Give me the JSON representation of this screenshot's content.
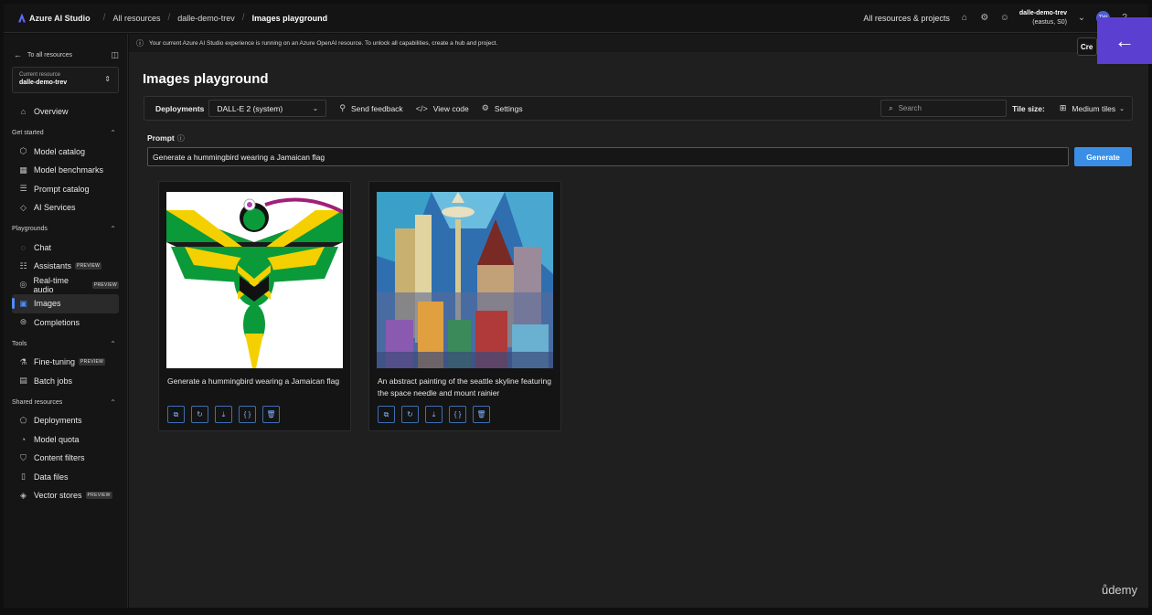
{
  "topbar": {
    "app_name": "Azure AI Studio",
    "breadcrumbs": [
      "All resources",
      "dalle-demo-trev",
      "Images playground"
    ],
    "project_switcher": "All resources & projects",
    "account_name": "dalle-demo-trev",
    "account_region": "(eastus, S0)",
    "avatar_initials": "TW"
  },
  "sidebar": {
    "back_label": "To all resources",
    "resource_label": "Current resource",
    "resource_value": "dalle-demo-trev",
    "overview": "Overview",
    "sections": [
      {
        "title": "Get started",
        "items": [
          "Model catalog",
          "Model benchmarks",
          "Prompt catalog",
          "AI Services"
        ]
      },
      {
        "title": "Playgrounds",
        "items": [
          "Chat",
          "Assistants",
          "Real-time audio",
          "Images",
          "Completions"
        ]
      },
      {
        "title": "Tools",
        "items": [
          "Fine-tuning",
          "Batch jobs"
        ]
      },
      {
        "title": "Shared resources",
        "items": [
          "Deployments",
          "Model quota",
          "Content filters",
          "Data files",
          "Vector stores"
        ]
      }
    ],
    "badge": "PREVIEW",
    "active_item": "Images"
  },
  "info_bar": {
    "message": "Your current Azure AI Studio experience is running on an Azure OpenAI resource. To unlock all capabilities, create a hub and project.",
    "create_label": "Cre"
  },
  "main": {
    "title": "Images playground",
    "toolbar": {
      "deployments_label": "Deployments",
      "deployment_value": "DALL-E 2 (system)",
      "send_feedback": "Send feedback",
      "view_code": "View code",
      "settings": "Settings",
      "search_placeholder": "Search",
      "tile_size_label": "Tile size:",
      "tile_size_value": "Medium tiles"
    },
    "prompt_label": "Prompt",
    "prompt_value": "Generate a hummingbird wearing a Jamaican flag",
    "generate": "Generate",
    "cards": [
      {
        "caption": "Generate a hummingbird wearing a Jamaican flag"
      },
      {
        "caption": "An abstract painting of the seattle skyline featuring the space needle and mount rainier"
      }
    ]
  },
  "watermark": "ůdemy",
  "colors": {
    "accent": "#3a8ee6",
    "overlay_button": "#5b3fd1"
  }
}
